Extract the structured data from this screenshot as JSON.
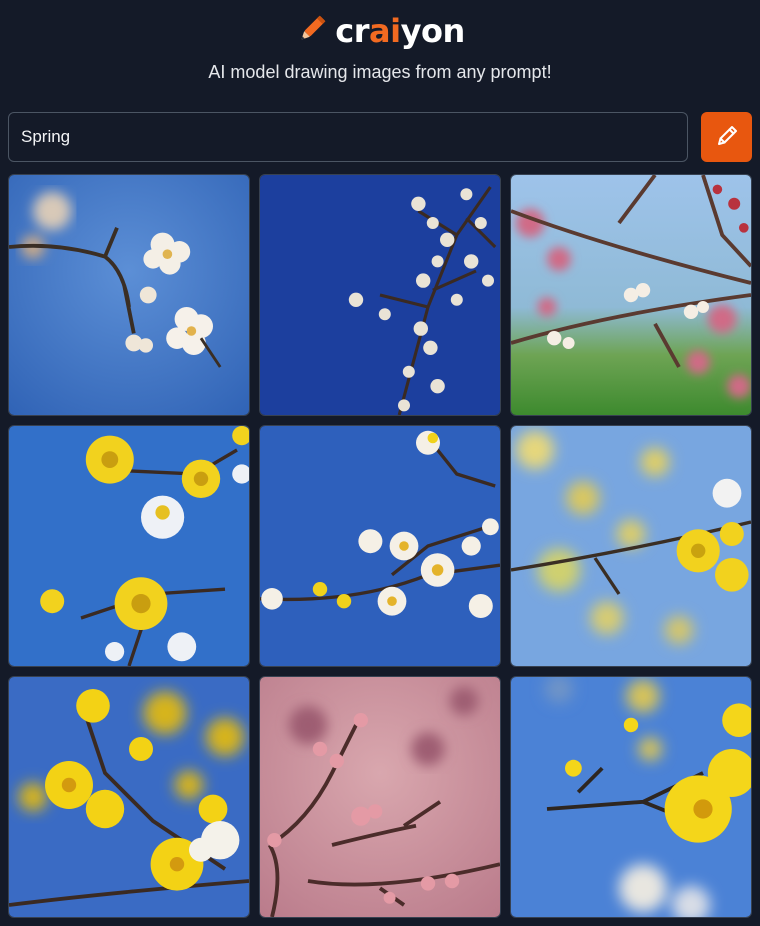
{
  "brand": {
    "part1": "cr",
    "accent": "ai",
    "part2": "yon",
    "accent_color": "#f26a21"
  },
  "tagline": "AI model drawing images from any prompt!",
  "prompt": {
    "value": "Spring"
  },
  "draw_button": {
    "icon": "pencil-icon",
    "color": "#e8570f"
  },
  "images": [
    {
      "subject": "white blossom on blue sky"
    },
    {
      "subject": "white blossom branch on deep blue"
    },
    {
      "subject": "pink blossom branches with green field"
    },
    {
      "subject": "yellow and white flowers"
    },
    {
      "subject": "white blossom sprig"
    },
    {
      "subject": "yellow flowers blurred"
    },
    {
      "subject": "yellow flowers close-up"
    },
    {
      "subject": "pink buds on branches"
    },
    {
      "subject": "yellow flower on branch"
    }
  ]
}
